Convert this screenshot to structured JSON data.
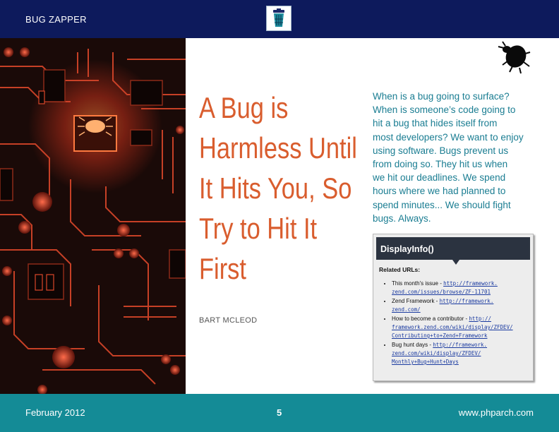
{
  "header": {
    "section_title": "BUG ZAPPER",
    "logo_icon": "trash-can-logo-icon"
  },
  "article": {
    "title_lines": [
      "A Bug is",
      "Harmless Until",
      "It Hits You, So",
      "Try to Hit It",
      "First"
    ],
    "author": "BART MCLEOD",
    "intro_lines": [
      "When is a bug going to surface?",
      "When is someone’s code going to",
      "hit a bug that hides itself from",
      "most developers? We want to enjoy",
      "using software. Bugs prevent us",
      "from doing so. They hit us when",
      "we hit our deadlines. We spend",
      "hours where we had planned to",
      "spend minutes... We should fight",
      "bugs. Always."
    ],
    "bug_icon": "beetle-icon",
    "art_icon": "circuit-board-bug-illustration"
  },
  "sidebar": {
    "title": "DisplayInfo()",
    "related_label": "Related URLs:",
    "items": [
      {
        "label": "This month's issue - ",
        "url_lines": [
          "http://framework.",
          "zend.com/issues/browse/ZF-11701"
        ]
      },
      {
        "label": "Zend Framework - ",
        "url_lines": [
          "http://framework.",
          "zend.com/"
        ]
      },
      {
        "label": "How to become a contributor - ",
        "url_lines": [
          "http://",
          "framework.zend.com/wiki/display/ZFDEV/",
          "Contributing+to+Zend+Framework"
        ]
      },
      {
        "label": "Bug hunt days - ",
        "url_lines": [
          "http://framework.",
          "zend.com/wiki/display/ZFDEV/",
          "Monthly+Bug+Hunt+Days"
        ]
      }
    ]
  },
  "footer": {
    "date": "February 2012",
    "page": "5",
    "site": "www.phparch.com"
  },
  "colors": {
    "header_bg": "#0d1a5c",
    "footer_bg": "#148b96",
    "title": "#d95d2e",
    "intro_text": "#1a7d92"
  }
}
